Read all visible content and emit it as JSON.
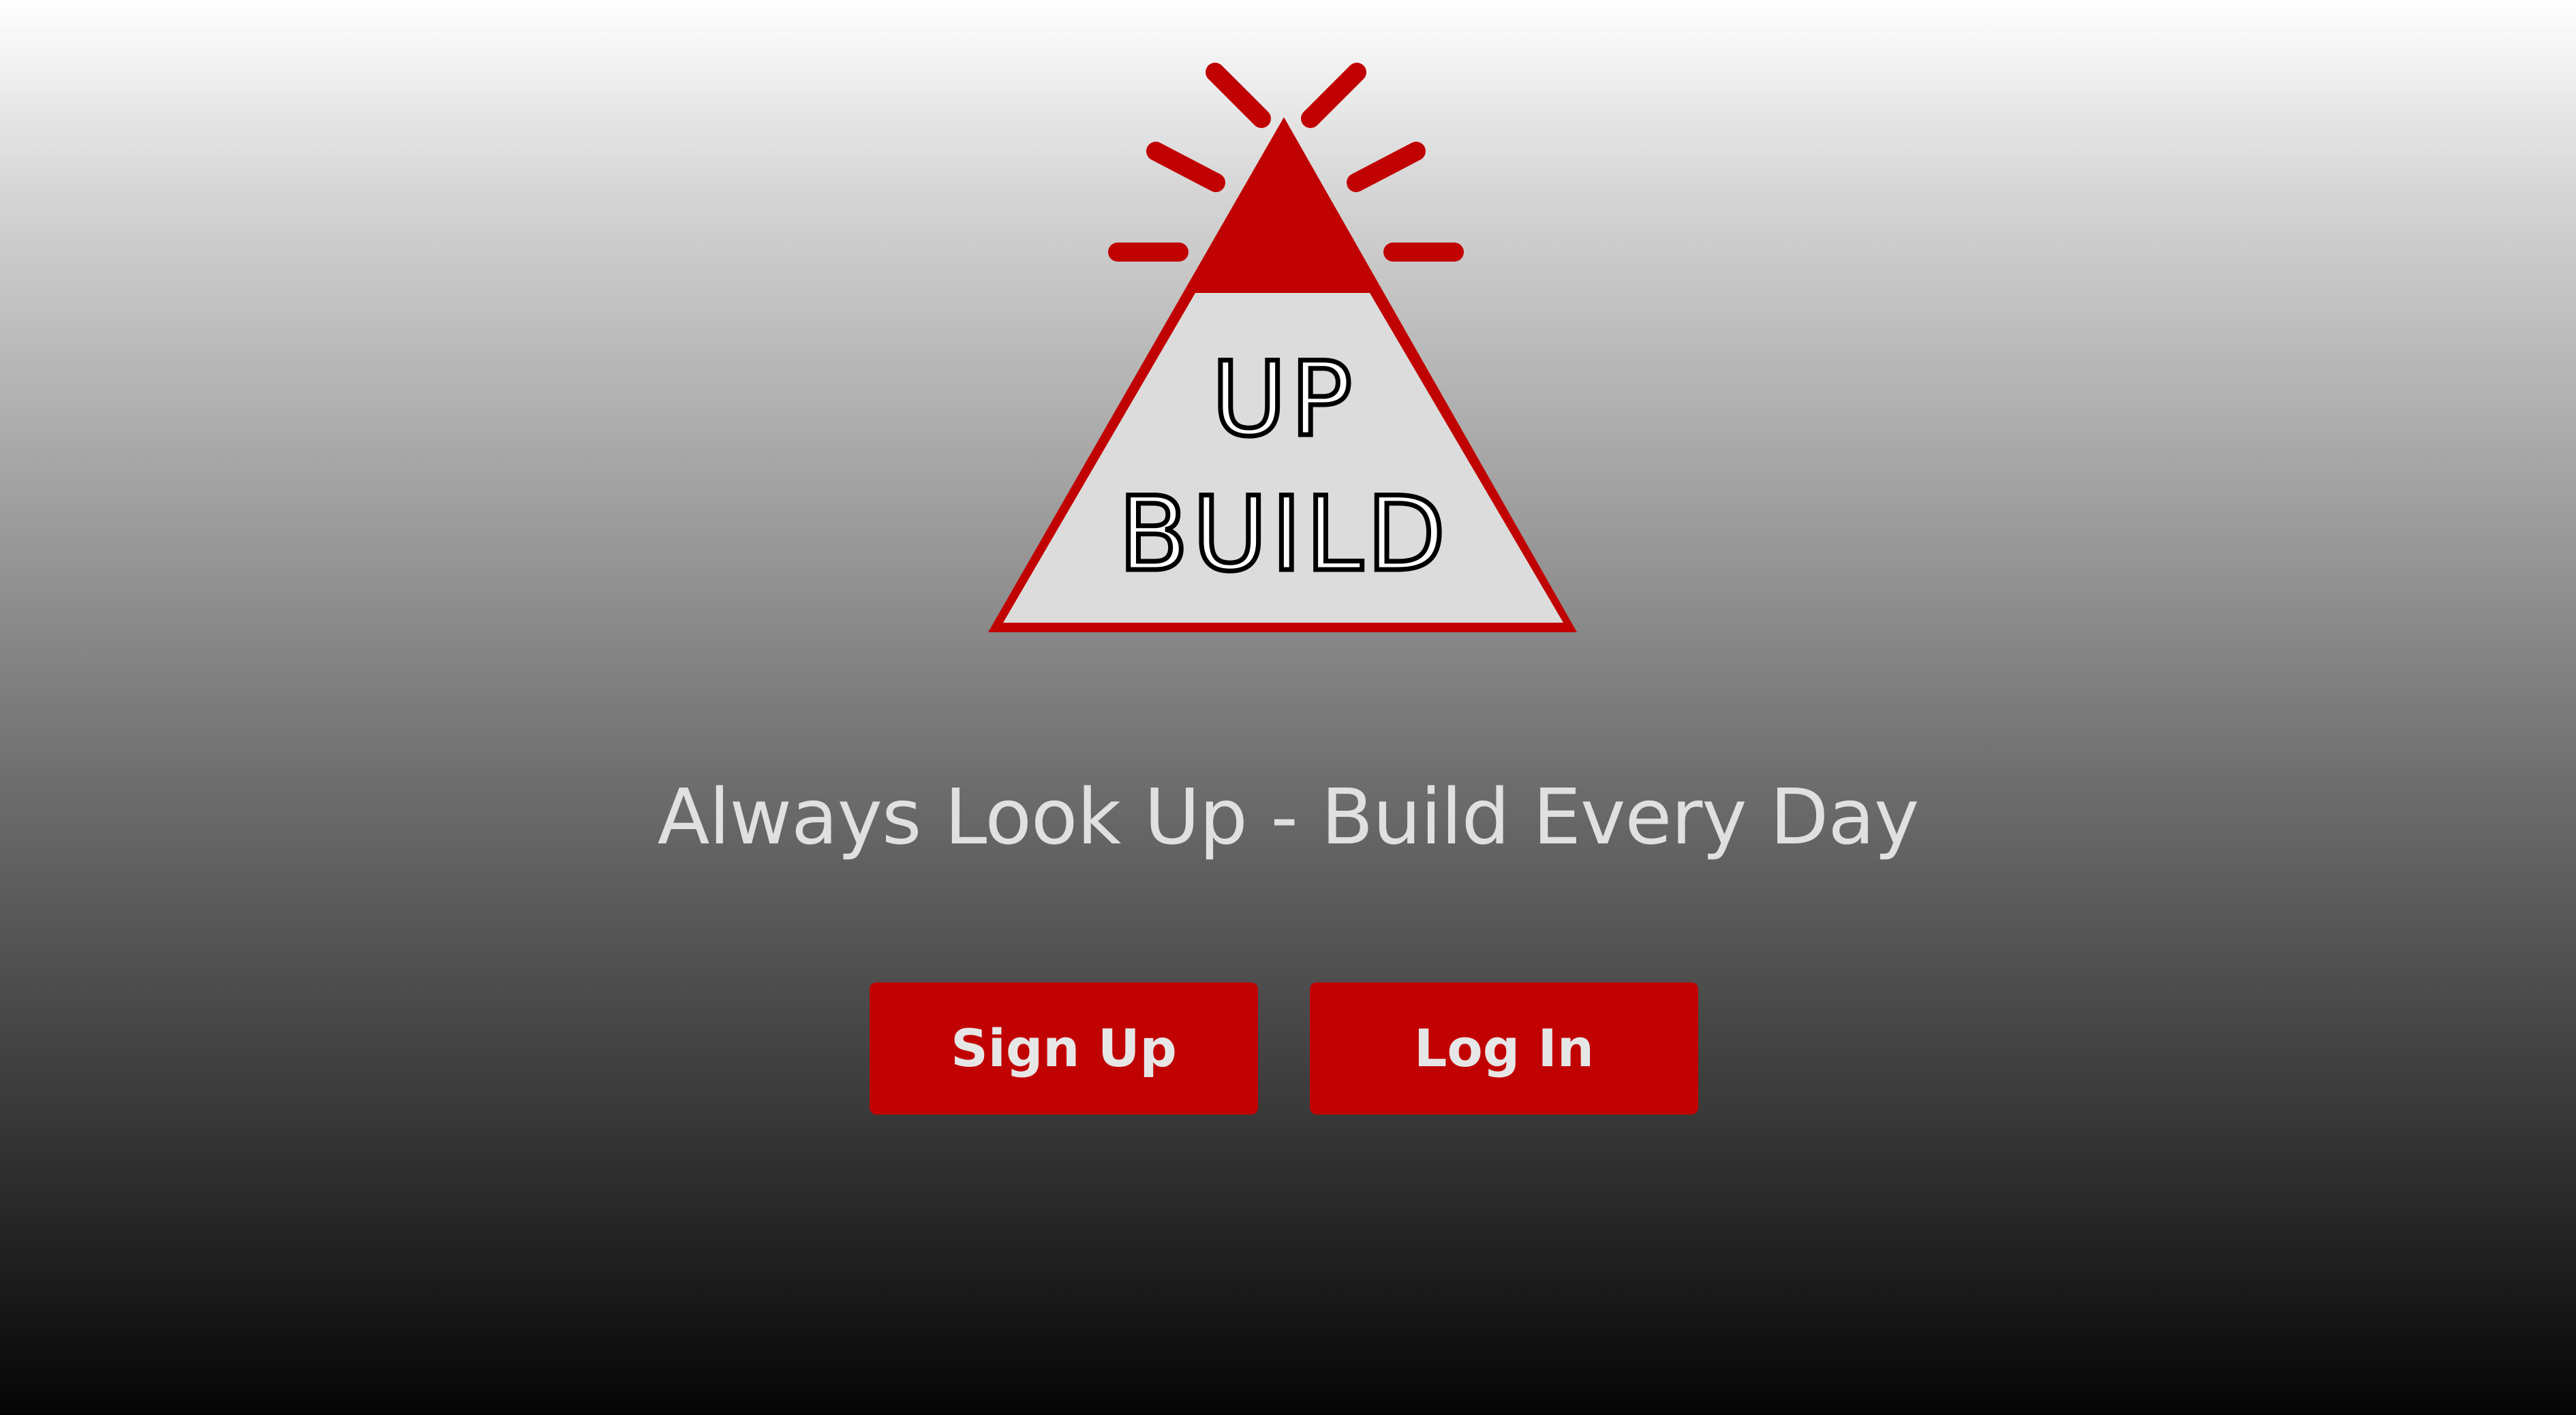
{
  "logo": {
    "line1": "UP",
    "line2": "BUILD",
    "accent_color": "#c10202",
    "fill_color": "#dcdcdc",
    "icon": "alarm-beacon-triangle"
  },
  "tagline": "Always Look Up - Build Every Day",
  "buttons": {
    "signup_label": "Sign Up",
    "login_label": "Log In",
    "color": "#c10202"
  }
}
